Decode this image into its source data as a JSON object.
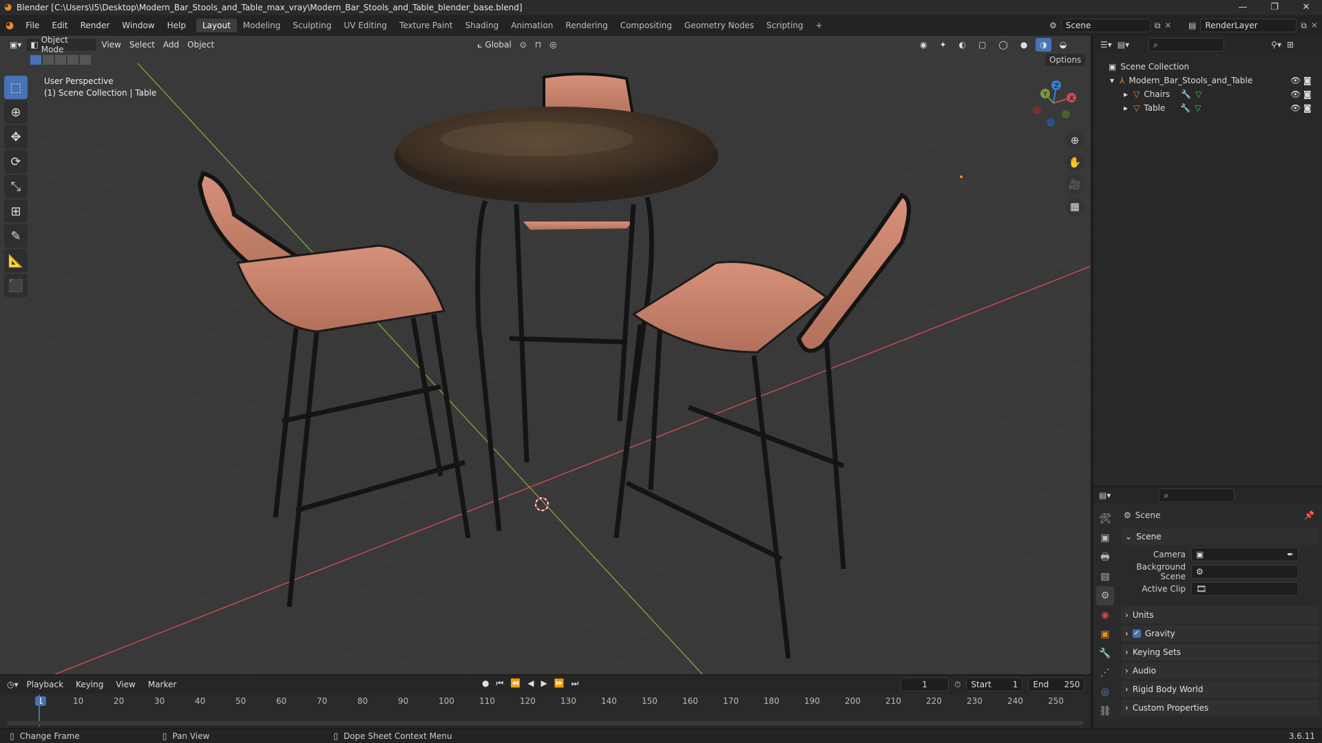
{
  "window": {
    "title": "Blender [C:\\Users\\I5\\Desktop\\Modern_Bar_Stools_and_Table_max_vray\\Modern_Bar_Stools_and_Table_blender_base.blend]",
    "controls": [
      "—",
      "❐",
      "✕"
    ]
  },
  "menubar": {
    "items": [
      "File",
      "Edit",
      "Render",
      "Window",
      "Help"
    ],
    "add_tab_glyph": "+"
  },
  "workspaces": {
    "tabs": [
      "Layout",
      "Modeling",
      "Sculpting",
      "UV Editing",
      "Texture Paint",
      "Shading",
      "Animation",
      "Rendering",
      "Compositing",
      "Geometry Nodes",
      "Scripting"
    ],
    "active": "Layout"
  },
  "scene_selector": {
    "value": "Scene"
  },
  "view_layer_selector": {
    "value": "RenderLayer"
  },
  "viewport_header": {
    "mode": "Object Mode",
    "menus": [
      "View",
      "Select",
      "Add",
      "Object"
    ],
    "transform_orientation": "Global",
    "options_label": "Options"
  },
  "viewport_overlay": {
    "line1": "User Perspective",
    "line2": "(1) Scene Collection | Table"
  },
  "gizmo": {
    "x": "X",
    "y": "Y",
    "z": "Z"
  },
  "outliner": {
    "root": "Scene Collection",
    "collection": "Modern_Bar_Stools_and_Table",
    "objects": [
      "Chairs",
      "Table"
    ]
  },
  "properties": {
    "context": "Scene",
    "panel": "Scene",
    "fields": [
      {
        "label": "Camera",
        "value": ""
      },
      {
        "label": "Background Scene",
        "value": ""
      },
      {
        "label": "Active Clip",
        "value": ""
      }
    ],
    "subpanels": [
      "Units",
      "Gravity",
      "Keying Sets",
      "Audio",
      "Rigid Body World",
      "Custom Properties"
    ],
    "gravity_checked": true
  },
  "timeline": {
    "menus": [
      "Playback",
      "Keying",
      "View",
      "Marker"
    ],
    "current_frame": "1",
    "start_label": "Start",
    "start": "1",
    "end_label": "End",
    "end": "250",
    "ticks": [
      "1",
      "10",
      "20",
      "30",
      "40",
      "50",
      "60",
      "70",
      "80",
      "90",
      "100",
      "110",
      "120",
      "130",
      "140",
      "150",
      "160",
      "170",
      "180",
      "190",
      "200",
      "210",
      "220",
      "230",
      "240",
      "250"
    ]
  },
  "statusbar": {
    "hints": [
      "Change Frame",
      "Pan View",
      "Dope Sheet Context Menu"
    ],
    "version": "3.6.11"
  },
  "colors": {
    "accent": "#4772b3",
    "chair_seat": "#c9826a",
    "table_top": "#4a3a2c",
    "x_axis": "#c94b55",
    "y_axis": "#7a9a3a"
  }
}
